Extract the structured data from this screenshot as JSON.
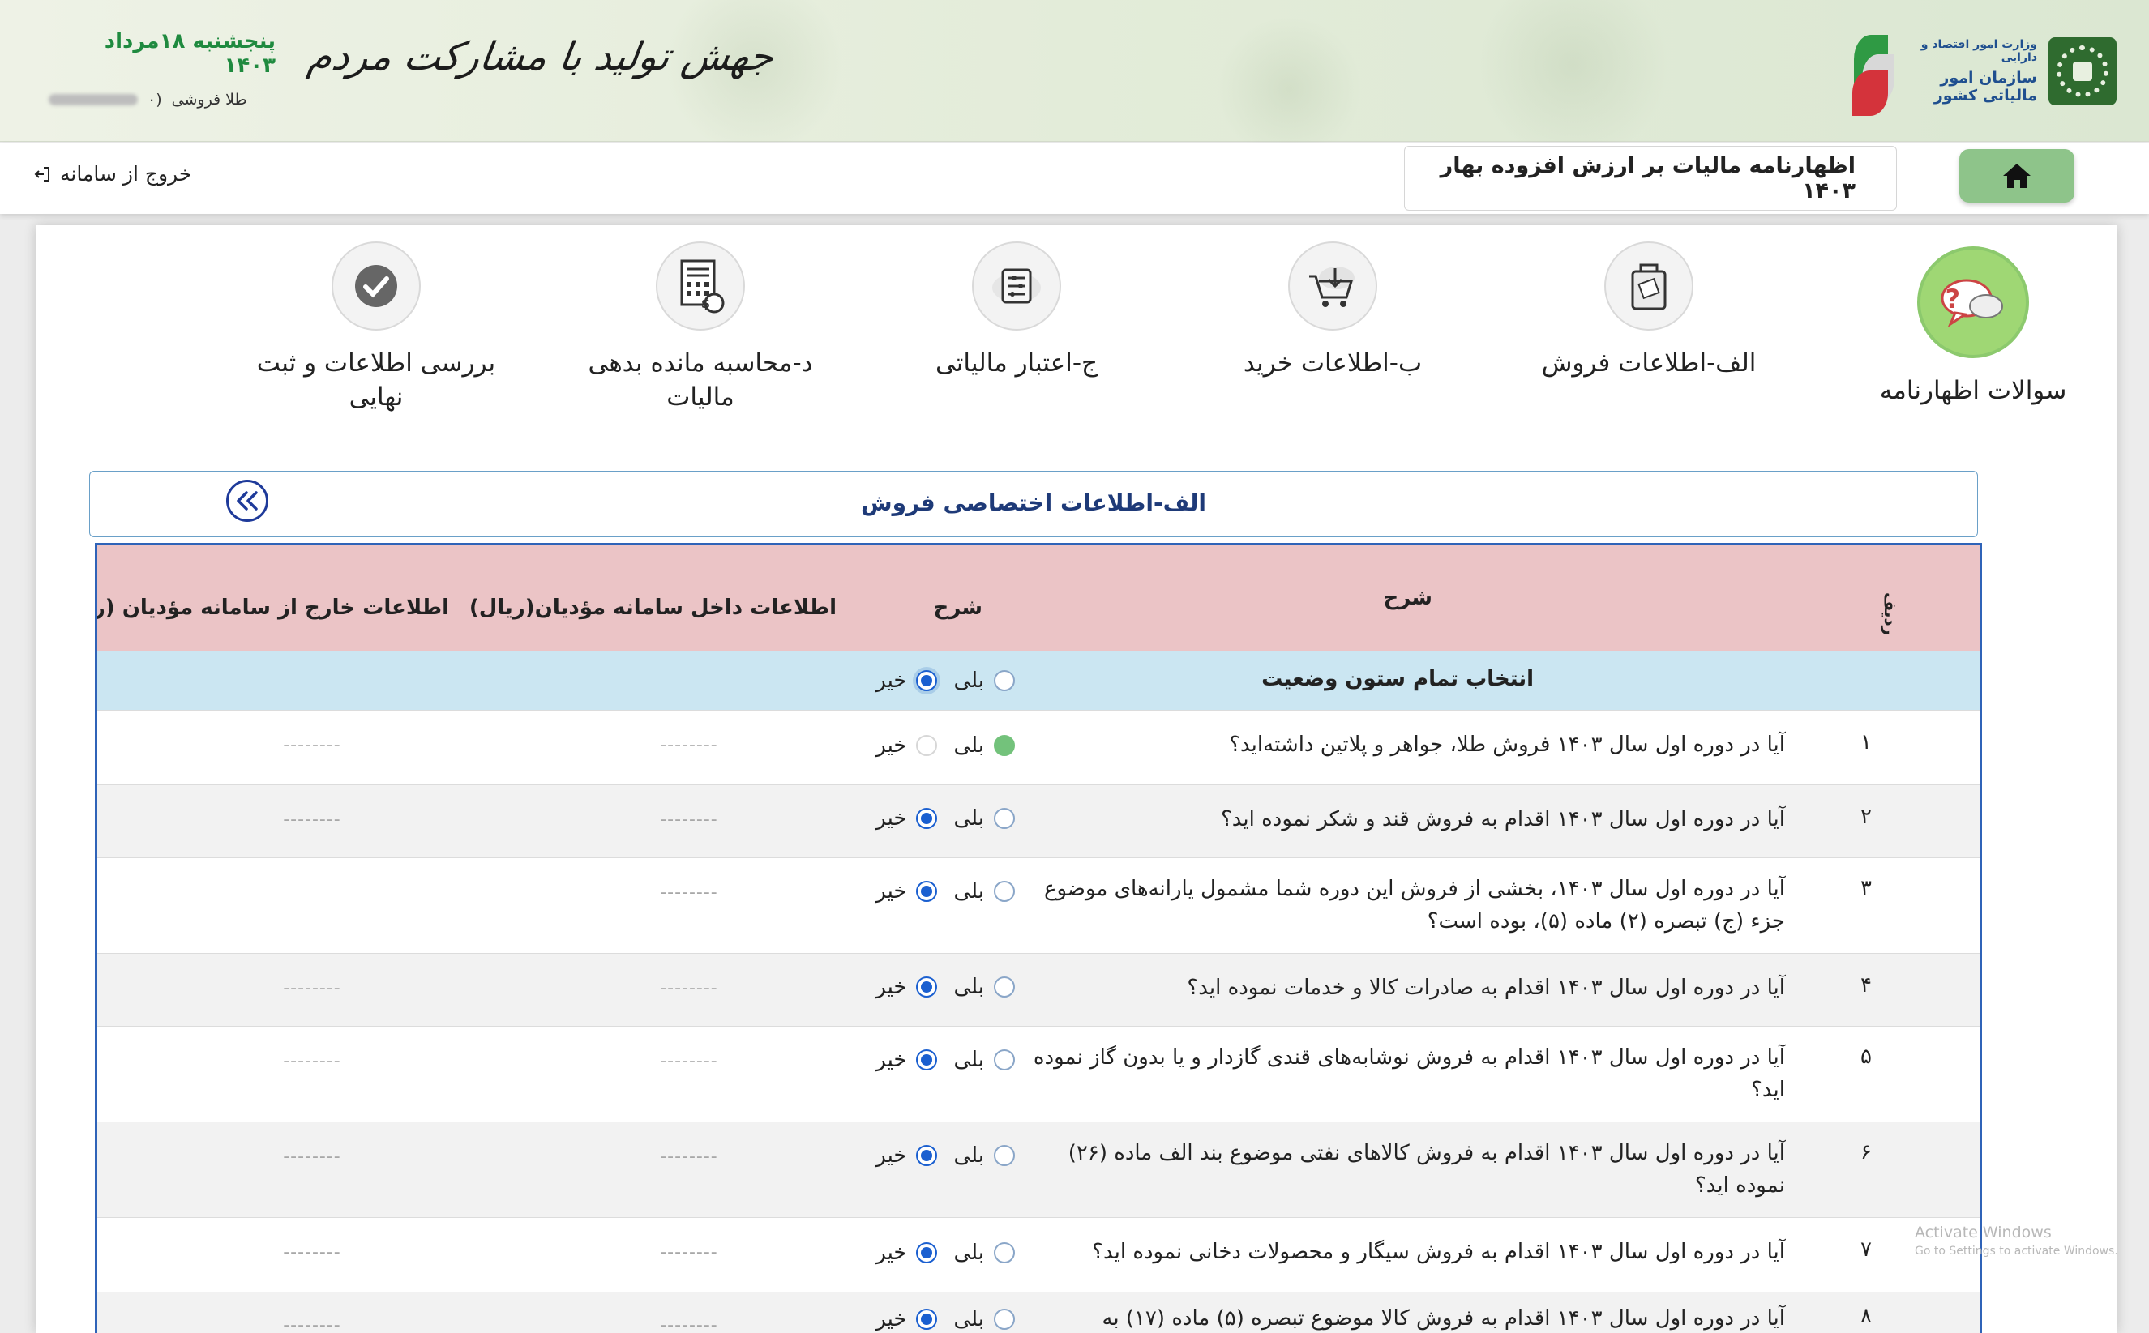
{
  "header": {
    "org_line1": "وزارت امور اقتصاد و دارایی",
    "org_line2": "سازمان امور مالیاتی کشور",
    "slogan": "جهش تولید با مشارکت مردم",
    "date": "پنجشنبه ۱۸مرداد ۱۴۰۳",
    "user_type": "طلا فروشی",
    "user_suffix": "(۰"
  },
  "navbar": {
    "home_icon": "home-icon",
    "page_title": "اظهارنامه مالیات بر ارزش افزوده بهار ۱۴۰۳",
    "logout_label": "خروج از سامانه"
  },
  "steps": [
    {
      "label": "سوالات اظهارنامه",
      "icon": "question-chat-icon",
      "active": true
    },
    {
      "label": "الف-اطلاعات فروش",
      "icon": "sales-bag-icon",
      "active": false
    },
    {
      "label": "ب-اطلاعات خرید",
      "icon": "shopping-cart-icon",
      "active": false
    },
    {
      "label": "ج-اعتبار مالیاتی",
      "icon": "tax-credit-icon",
      "active": false
    },
    {
      "label": "د-محاسبه مانده بدهی مالیات",
      "icon": "calculator-icon",
      "active": false
    },
    {
      "label": "بررسی اطلاعات و ثبت نهایی",
      "icon": "verified-check-icon",
      "active": false
    }
  ],
  "section": {
    "title": "الف-اطلاعات اختصاصی فروش"
  },
  "table": {
    "headers": {
      "rownum": "ردیف",
      "description": "شرح",
      "status": "شرح",
      "inside_system": "اطلاعات داخل سامانه مؤدیان(ریال)",
      "outside_system": "اطلاعات خارج از سامانه مؤدیان (ریال)"
    },
    "select_all_label": "انتخاب تمام ستون وضعیت",
    "yes_label": "بلی",
    "no_label": "خیر",
    "placeholder": "--------",
    "rows": [
      {
        "num": "۱",
        "question": "آیا در دوره اول سال ۱۴۰۳ فروش طلا، جواهر و پلاتین داشته‌اید؟",
        "answer": "yes",
        "inside": "--------",
        "outside": "--------"
      },
      {
        "num": "۲",
        "question": "آیا در دوره اول سال ۱۴۰۳ اقدام به فروش قند و شکر نموده اید؟",
        "answer": "no",
        "inside": "--------",
        "outside": "--------"
      },
      {
        "num": "۳",
        "question": "آیا در دوره اول سال ۱۴۰۳، بخشی از فروش این دوره شما مشمول یارانه‌های موضوع جزء (ج) تبصره (۲) ماده (۵)، بوده است؟",
        "answer": "no",
        "inside": "--------",
        "outside": ""
      },
      {
        "num": "۴",
        "question": "آیا در دوره اول سال ۱۴۰۳ اقدام به صادرات کالا و خدمات نموده اید؟",
        "answer": "no",
        "inside": "--------",
        "outside": "--------"
      },
      {
        "num": "۵",
        "question": "آیا در دوره اول سال ۱۴۰۳ اقدام به فروش نوشابه‌های قندی گازدار و یا بدون گاز نموده اید؟",
        "answer": "no",
        "inside": "--------",
        "outside": "--------"
      },
      {
        "num": "۶",
        "question": "آیا در دوره اول سال ۱۴۰۳ اقدام به فروش کالاهای نفتی موضوع بند الف ماده (۲۶) نموده اید؟",
        "answer": "no",
        "inside": "--------",
        "outside": "--------"
      },
      {
        "num": "۷",
        "question": "آیا در دوره اول سال ۱۴۰۳ اقدام به فروش سیگار و محصولات دخانی نموده اید؟",
        "answer": "no",
        "inside": "--------",
        "outside": "--------"
      },
      {
        "num": "۸",
        "question": "آیا در دوره اول سال ۱۴۰۳ اقدام به فروش کالا موضوع تبصره (۵) ماده (۱۷) به",
        "answer": "no",
        "inside": "--------",
        "outside": "--------"
      }
    ]
  },
  "watermark": {
    "line1": "Activate Windows",
    "line2": "Go to Settings to activate Windows."
  },
  "colors": {
    "active_step": "#9fd774",
    "table_header": "#ebc4c6",
    "select_all_row": "#cbe6f2",
    "table_border": "#2f63b8",
    "section_title": "#1e3a78",
    "date_green": "#1f8a3f",
    "home_button": "#8ec48a"
  }
}
